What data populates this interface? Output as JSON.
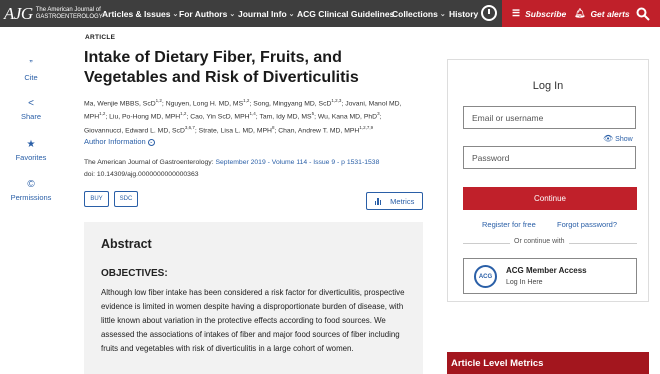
{
  "logo": {
    "mark": "AJG",
    "line1": "The American Journal of",
    "line2": "GASTROENTEROLOGY"
  },
  "nav": {
    "items": [
      "Articles & Issues",
      "For Authors",
      "Journal Info",
      "ACG Clinical Guidelines",
      "Collections",
      "History"
    ],
    "subscribe": "Subscribe",
    "alerts": "Get alerts"
  },
  "sidebar": [
    "Cite",
    "Share",
    "Favorites",
    "Permissions"
  ],
  "article": {
    "kicker": "ARTICLE",
    "title": "Intake of Dietary Fiber, Fruits, and Vegetables and Risk of Diverticulitis",
    "authors": [
      {
        "name": "Ma, Wenjie MBBS, ScD",
        "sup": "1,2",
        "sep": "; "
      },
      {
        "name": "Nguyen, Long H. MD, MS",
        "sup": "1,2",
        "sep": "; "
      },
      {
        "name": "Song, Mingyang MD, ScD",
        "sup": "1,2,3",
        "sep": "; "
      },
      {
        "name": "Jovani, Manol MD, MPH",
        "sup": "1,2",
        "sep": "; "
      },
      {
        "name": "Liu, Po-Hong MD, MPH",
        "sup": "1,2",
        "sep": "; "
      },
      {
        "name": "Cao, Yin ScD, MPH",
        "sup": "1,4",
        "sep": "; "
      },
      {
        "name": "Tam, Idy MD, MS",
        "sup": "5",
        "sep": "; "
      },
      {
        "name": "Wu, Kana MD, PhD",
        "sup": "3",
        "sep": "; "
      },
      {
        "name": "Giovannucci, Edward L. MD, ScD",
        "sup": "3,6,7",
        "sep": "; "
      },
      {
        "name": "Strate, Lisa L. MD, MPH",
        "sup": "8",
        "sep": "; "
      },
      {
        "name": "Chan, Andrew T. MD, MPH",
        "sup": "1,2,7,9",
        "sep": ""
      }
    ],
    "author_info": "Author Information",
    "journal_prefix": "The American Journal of Gastroenterology: ",
    "journal_link": "September 2019 - Volume 114 - Issue 9 - p 1531-1538",
    "doi": "doi: 10.14309/ajg.0000000000000363",
    "buy": "BUY",
    "sdc": "SDC",
    "metrics": "Metrics"
  },
  "abstract": {
    "title": "Abstract",
    "subheading": "OBJECTIVES:",
    "text": "Although low fiber intake has been considered a risk factor for diverticulitis, prospective evidence is limited in women despite having a disproportionate burden of disease, with little known about variation in the protective effects according to food sources. We assessed the associations of intakes of fiber and major food sources of fiber including fruits and vegetables with risk of diverticulitis in a large cohort of women."
  },
  "login": {
    "title": "Log In",
    "username_placeholder": "Email or username",
    "show": "Show",
    "password_placeholder": "Password",
    "continue": "Continue",
    "register": "Register for free",
    "forgot": "Forgot password?",
    "or": "Or continue with",
    "acg_logo": "ACG",
    "acg_title": "ACG Member Access",
    "acg_sub": "Log In Here"
  },
  "metrics_panel": {
    "title": "Article Level Metrics"
  },
  "colors": {
    "nav_bg": "#3e3e3e",
    "accent_red": "#c0202a",
    "link_blue": "#2a5fa7"
  },
  "icons": [
    "history-icon",
    "subscribe-icon",
    "bell-icon",
    "search-icon",
    "quote-icon",
    "share-icon",
    "star-icon",
    "copyright-icon",
    "eye-icon",
    "bar-chart-icon"
  ]
}
